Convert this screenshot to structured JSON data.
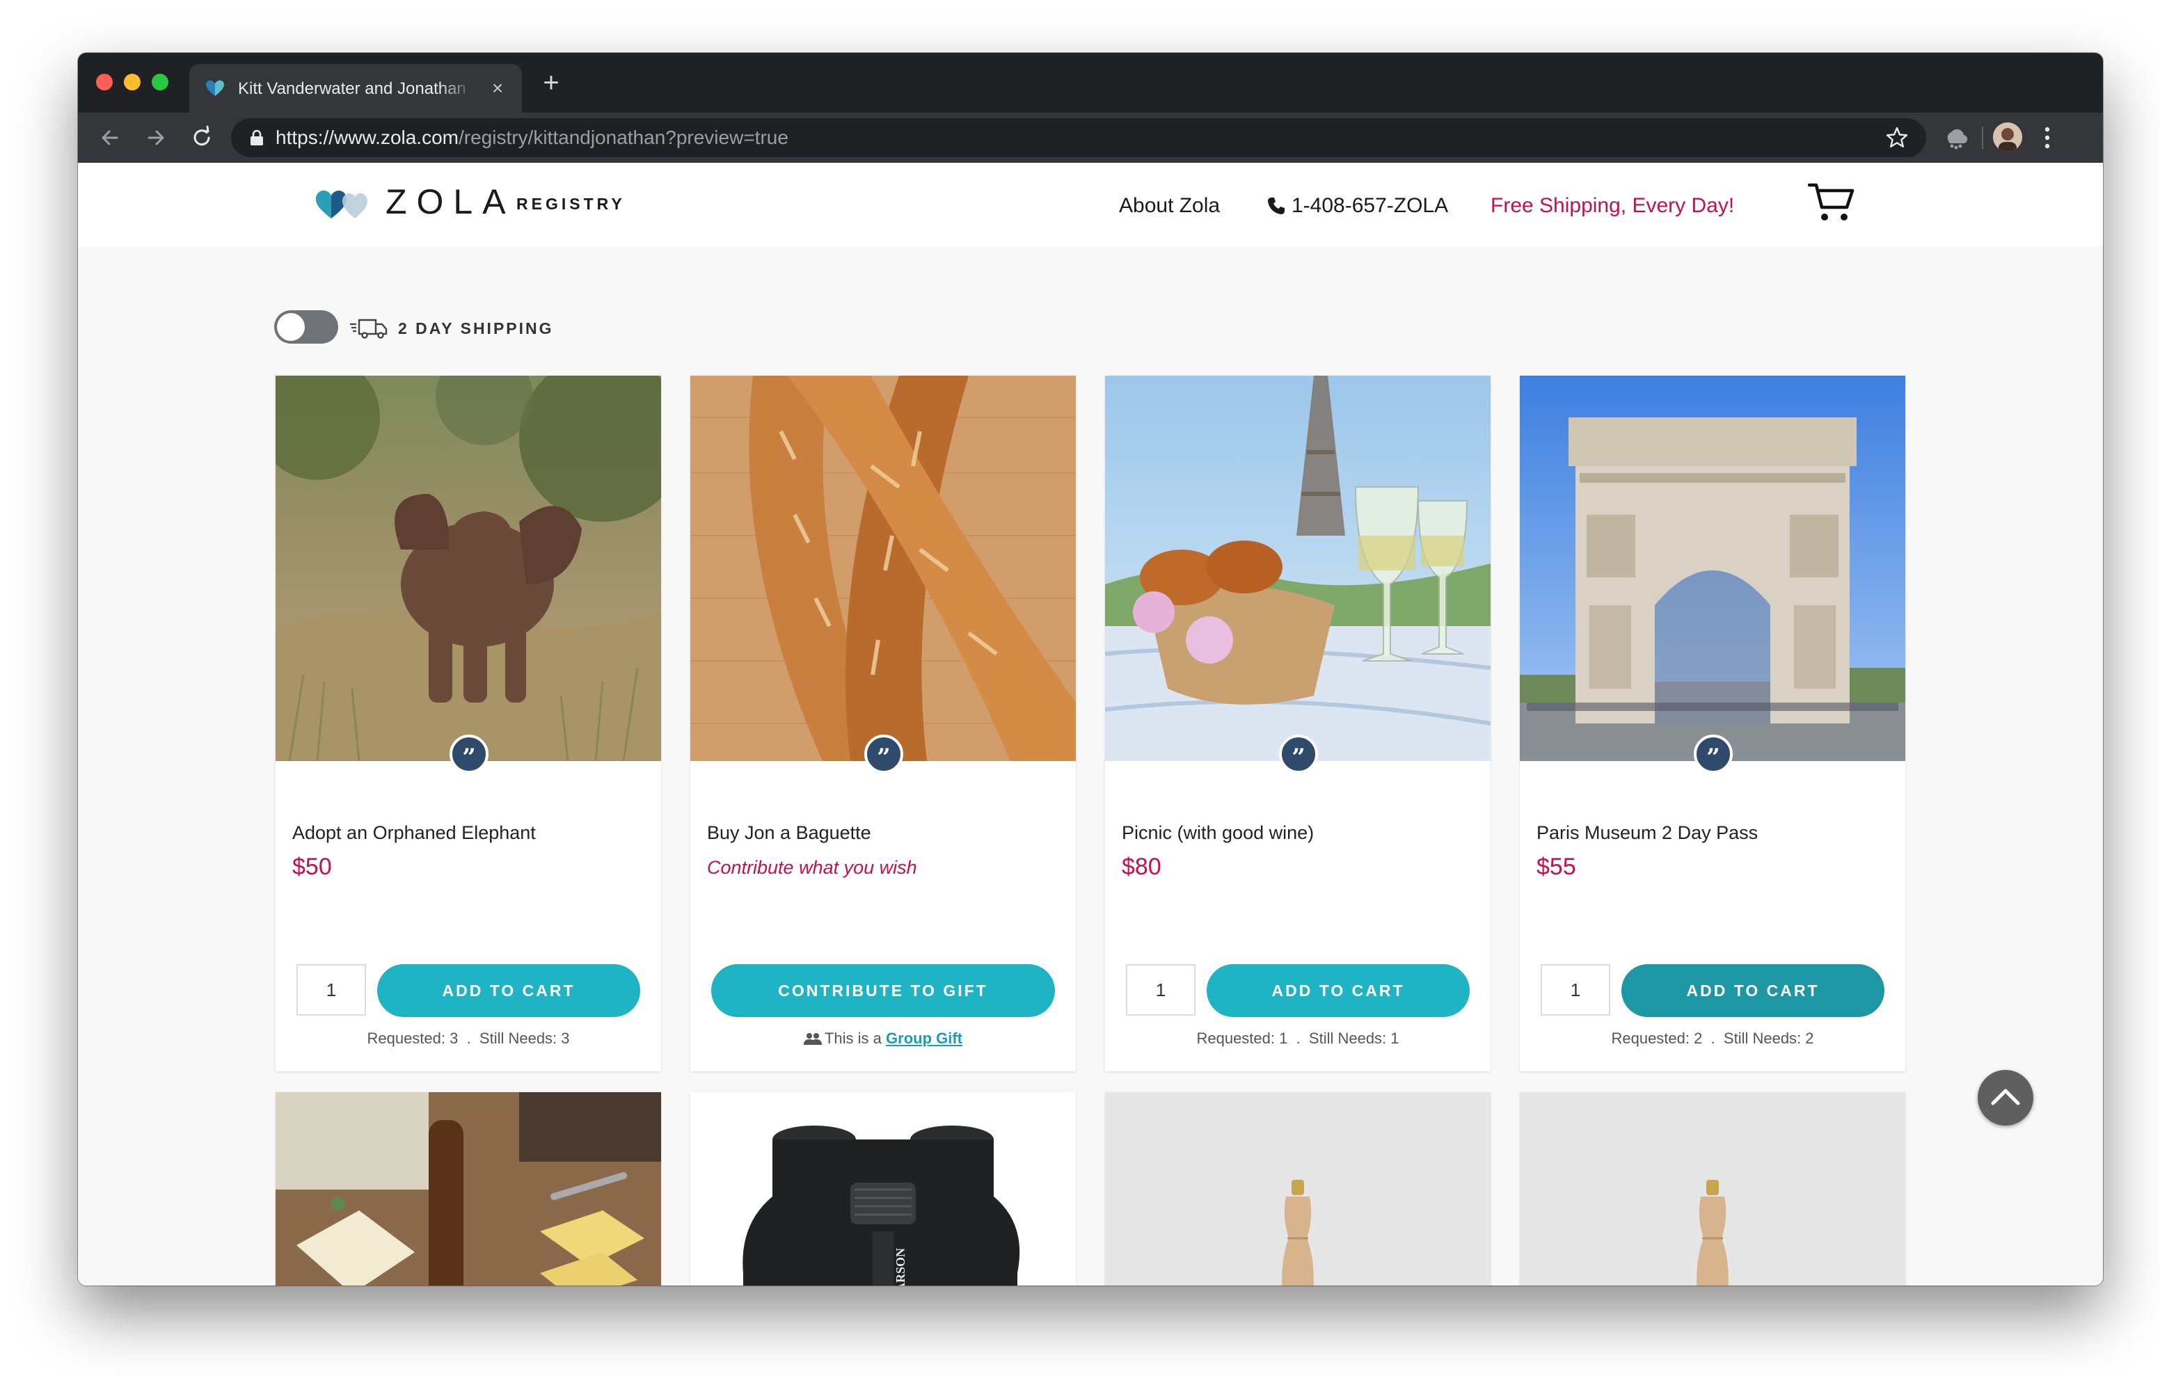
{
  "browser": {
    "tab_title": "Kitt Vanderwater and Jonathan",
    "url_host": "https://www.zola.com",
    "url_path": "/registry/kittandjonathan?preview=true"
  },
  "header": {
    "logo_text": "ZOLA",
    "logo_sub": "REGISTRY",
    "nav_about": "About Zola",
    "nav_phone": "1-408-657-ZOLA",
    "nav_shipping": "Free Shipping, Every Day!"
  },
  "shipping_filter": {
    "label": "2 DAY SHIPPING",
    "enabled": false
  },
  "products": [
    {
      "name": "Adopt an Orphaned Elephant",
      "price": "$50",
      "quantity": "1",
      "button": "ADD TO CART",
      "requested": "Requested: 3",
      "still_needs": "Still Needs: 3"
    },
    {
      "name": "Buy Jon a Baguette",
      "price_note": "Contribute what you wish",
      "button": "CONTRIBUTE TO GIFT",
      "group_prefix": "This is a",
      "group_link": "Group Gift"
    },
    {
      "name": "Picnic (with good wine)",
      "price": "$80",
      "quantity": "1",
      "button": "ADD TO CART",
      "requested": "Requested: 1",
      "still_needs": "Still Needs: 1"
    },
    {
      "name": "Paris Museum 2 Day Pass",
      "price": "$55",
      "quantity": "1",
      "button": "ADD TO CART",
      "requested": "Requested: 2",
      "still_needs": "Still Needs: 2"
    }
  ],
  "second_row_images": [
    "cheese-board",
    "carson-binoculars",
    "pepper-mill",
    "pepper-mill"
  ],
  "colors": {
    "accent_teal": "#1fb4c3",
    "price_pink": "#c4104d",
    "badge_navy": "#2f4a6b"
  },
  "icons": [
    "back-arrow-icon",
    "forward-arrow-icon",
    "reload-icon",
    "lock-icon",
    "star-icon",
    "phone-icon",
    "cart-icon",
    "truck-icon",
    "quote-icon",
    "chevron-up-icon"
  ]
}
